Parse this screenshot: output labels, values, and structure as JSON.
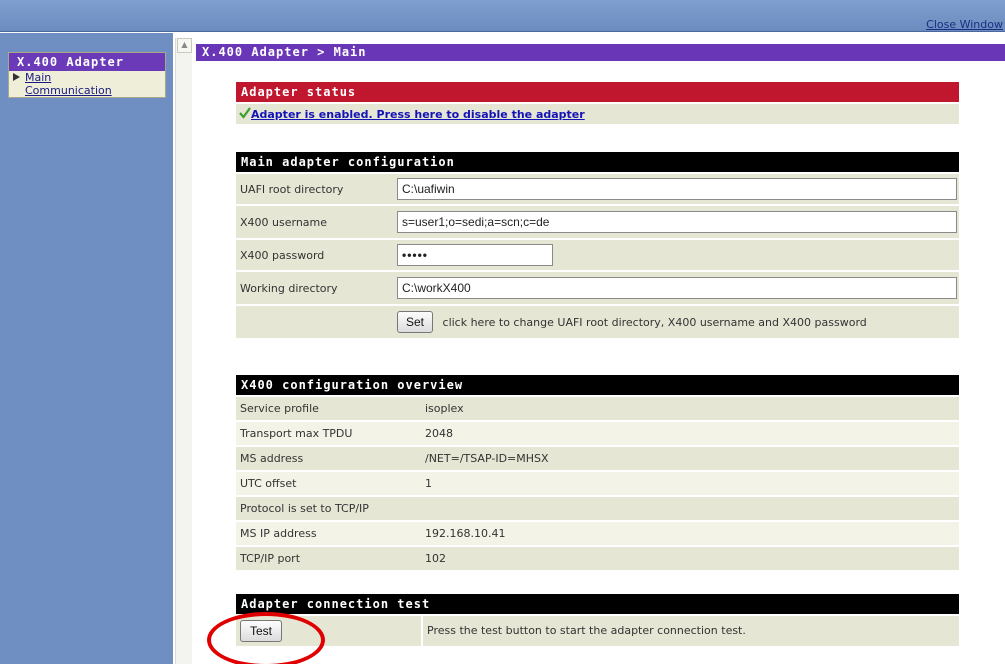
{
  "topbar": {
    "close_label": "Close Window"
  },
  "sidebar": {
    "title": "X.400 Adapter",
    "items": [
      {
        "label": "Main",
        "selected": true
      },
      {
        "label": "Communication",
        "selected": false
      }
    ]
  },
  "main": {
    "breadcrumb": "X.400 Adapter > Main",
    "status_section": {
      "title": "Adapter status",
      "status_link": "Adapter is enabled. Press here to disable the adapter",
      "status_color": "#1313b8"
    },
    "config_section": {
      "title": "Main adapter configuration",
      "fields": [
        {
          "label": "UAFI root directory",
          "value": "C:\\uafiwin"
        },
        {
          "label": "X400 username",
          "value": "s=user1;o=sedi;a=scn;c=de"
        },
        {
          "label": "X400 password",
          "value": "•••••"
        },
        {
          "label": "Working directory",
          "value": "C:\\workX400"
        }
      ],
      "set_button": "Set",
      "set_hint": "click here to change UAFI root directory, X400 username and X400 password"
    },
    "overview_section": {
      "title": "X400 configuration overview",
      "rows": [
        {
          "label": "Service profile",
          "value": "isoplex"
        },
        {
          "label": "Transport max TPDU",
          "value": "2048"
        },
        {
          "label": "MS address",
          "value": "/NET=/TSAP-ID=MHSX"
        },
        {
          "label": "UTC offset",
          "value": "1"
        },
        {
          "label": "Protocol is set to TCP/IP",
          "value": ""
        },
        {
          "label": "MS IP address",
          "value": "192.168.10.41"
        },
        {
          "label": "TCP/IP port",
          "value": "102"
        }
      ]
    },
    "test_section": {
      "title": "Adapter connection test",
      "test_button": "Test",
      "test_hint": "Press the test button to start the adapter connection test."
    }
  },
  "colors": {
    "header_purple": "#6a36b8",
    "status_red": "#c0162e",
    "sidebar_blue": "#6f8fc2",
    "callout_red": "#e00000"
  }
}
